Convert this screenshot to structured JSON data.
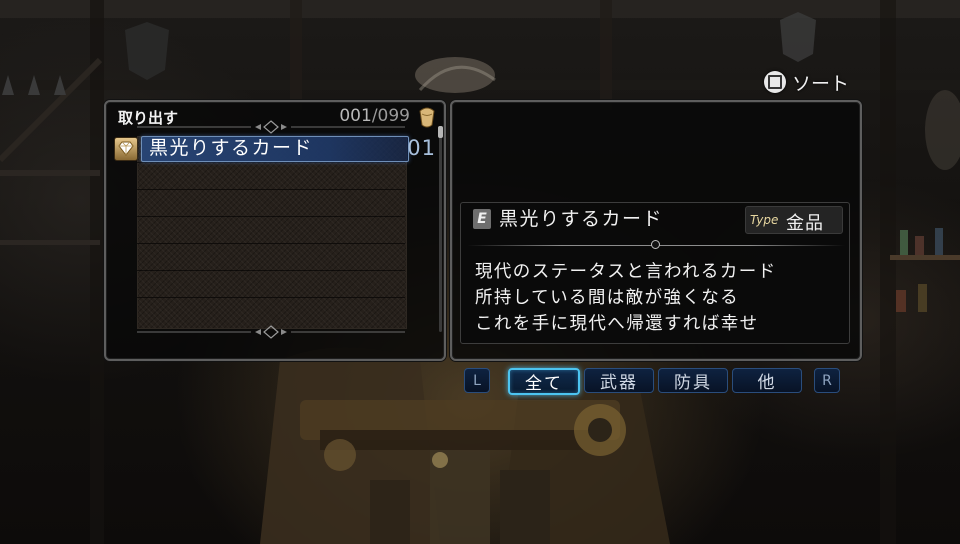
{
  "sort": {
    "icon": "square-button-icon",
    "label": "ソート"
  },
  "storage": {
    "title": "取り出す",
    "count_current": "001",
    "count_total": "/099",
    "items": [
      {
        "name": "黒光りするカード",
        "quantity": "01",
        "icon": "gem-icon",
        "selected": true
      }
    ]
  },
  "detail": {
    "badge": "E",
    "name": "黒光りするカード",
    "type_label": "Type",
    "type_value": "金品",
    "description": [
      "現代のステータスと言われるカード",
      "所持している間は敵が強くなる",
      "これを手に現代へ帰還すれば幸せ"
    ]
  },
  "tabs": {
    "left": "L",
    "items": [
      "全て",
      "武器",
      "防具",
      "他"
    ],
    "active": 0,
    "right": "R"
  },
  "colors": {
    "selection": "#1e3766",
    "tab_active_border": "#4cc4f0",
    "tab_border": "#2a4d7c",
    "panel_border": "#5e5e5e"
  }
}
